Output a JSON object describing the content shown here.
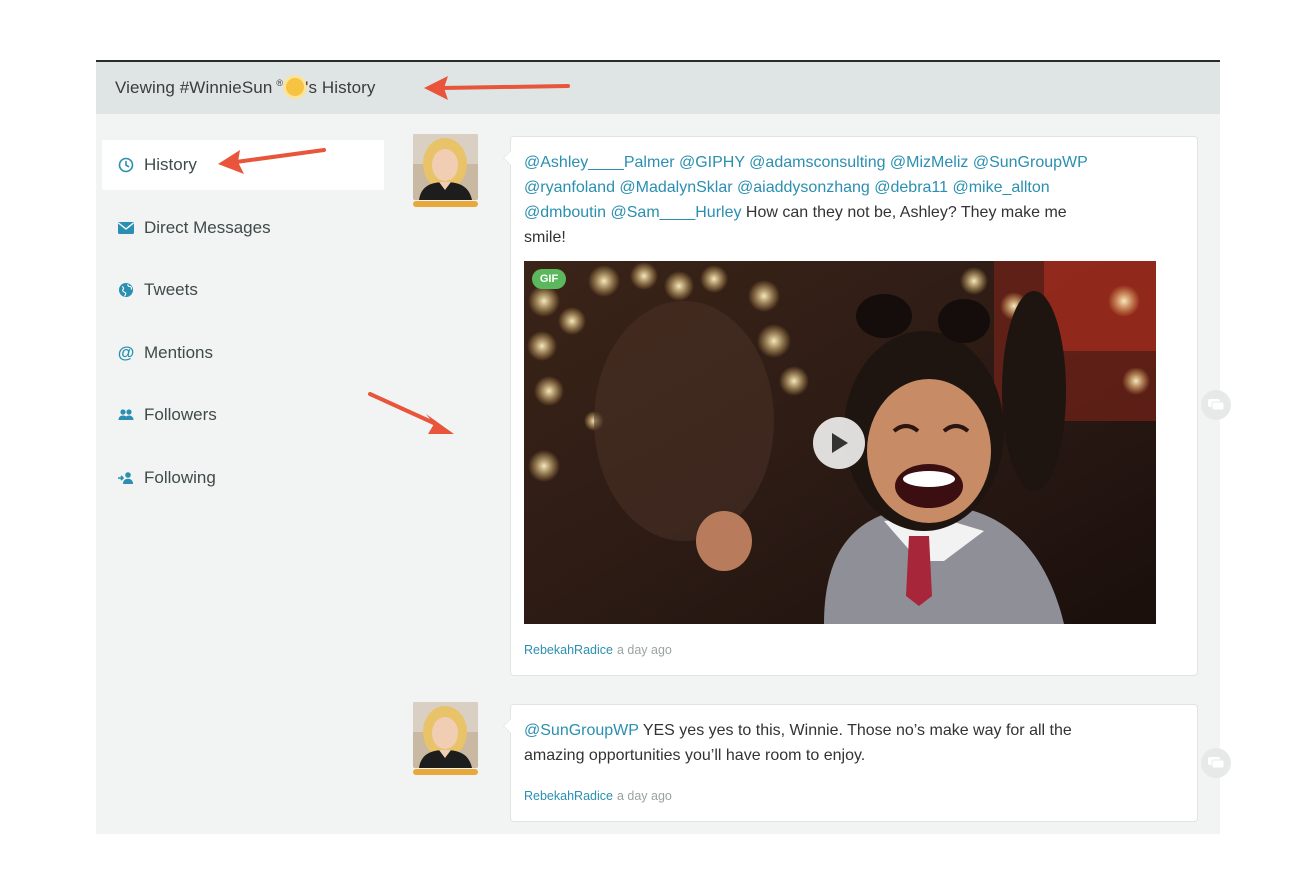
{
  "header": {
    "prefix": "Viewing #WinnieSun",
    "reg_mark": "®",
    "suffix": "'s History"
  },
  "sidebar": {
    "items": [
      {
        "label": "History",
        "icon": "clock-icon",
        "active": true
      },
      {
        "label": "Direct Messages",
        "icon": "envelope-icon"
      },
      {
        "label": "Tweets",
        "icon": "globe-icon"
      },
      {
        "label": "Mentions",
        "icon": "at-icon"
      },
      {
        "label": "Followers",
        "icon": "users-icon"
      },
      {
        "label": "Following",
        "icon": "user-follow-icon"
      }
    ]
  },
  "feed": {
    "posts": [
      {
        "mentions_line1": "@Ashley____Palmer @GIPHY @adamsconsulting @MizMeliz @SunGroupWP",
        "mentions_line2": "@ryanfoland @MadalynSklar @aiaddysonzhang @debra11 @mike_allton",
        "mentions_line3": "@dmboutin @Sam____Hurley",
        "text_line3": " How can they not be, Ashley? They make me",
        "text_line4": "smile!",
        "media_badge": "GIF",
        "author": "RebekahRadice",
        "time": "a day ago"
      },
      {
        "mention": "@SunGroupWP",
        "text_line1": " YES yes yes to this, Winnie. Those no’s make way for all the",
        "text_line2": "amazing opportunities you’ll have room to enjoy.",
        "author": "RebekahRadice",
        "time": "a day ago"
      }
    ]
  },
  "colors": {
    "accent_link": "#2a8fb0",
    "annotation_arrow": "#e8553b",
    "avatar_bar": "#e9a93a",
    "gif_badge": "#5cb85c"
  }
}
